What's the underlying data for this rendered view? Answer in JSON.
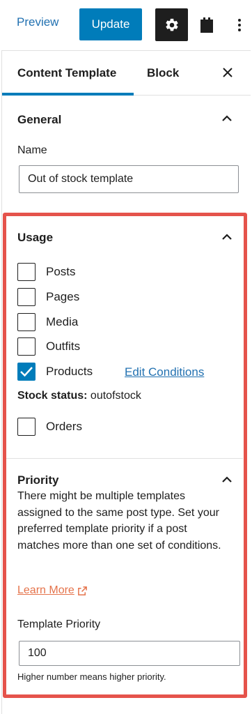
{
  "header": {
    "preview_label": "Preview",
    "update_label": "Update",
    "settings_icon": "gear-icon",
    "plugin_icon": "block-icon",
    "more_icon": "more-vertical-icon"
  },
  "tabs": {
    "content_template": "Content Template",
    "block": "Block",
    "close_icon": "close-icon"
  },
  "general": {
    "title": "General",
    "name_label": "Name",
    "name_value": "Out of stock template"
  },
  "usage": {
    "title": "Usage",
    "items": [
      {
        "label": "Posts",
        "checked": false
      },
      {
        "label": "Pages",
        "checked": false
      },
      {
        "label": "Media",
        "checked": false
      },
      {
        "label": "Outfits",
        "checked": false
      },
      {
        "label": "Products",
        "checked": true
      },
      {
        "label": "Orders",
        "checked": false
      }
    ],
    "edit_conditions": "Edit Conditions",
    "stock_status_label": "Stock status:",
    "stock_status_value": "outofstock"
  },
  "priority": {
    "title": "Priority",
    "description": "There might be multiple templates assigned to the same post type. Set your preferred template priority if a post matches more than one set of conditions.",
    "learn_more": "Learn More",
    "template_priority_label": "Template Priority",
    "template_priority_value": "100",
    "help_text": "Higher number means higher priority."
  },
  "colors": {
    "accent": "#007cba",
    "highlight_border": "#e5534b",
    "link": "#2271b1",
    "learn_more": "#e5734b"
  }
}
